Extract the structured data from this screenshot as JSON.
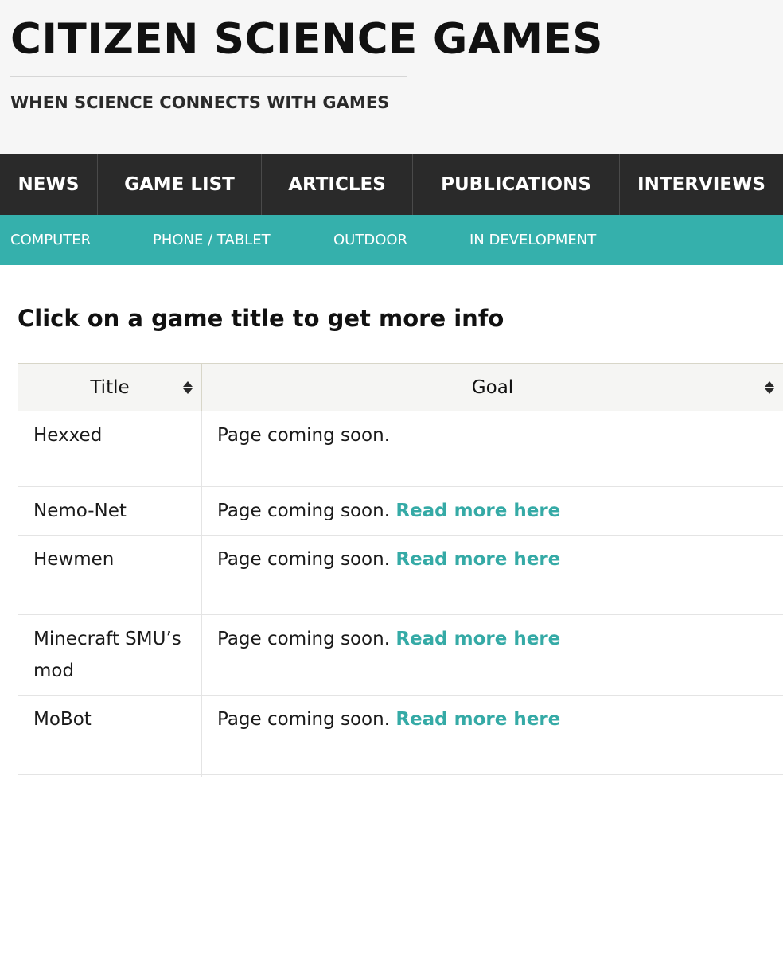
{
  "header": {
    "site_title": "CITIZEN SCIENCE GAMES",
    "tagline": "WHEN SCIENCE CONNECTS WITH GAMES"
  },
  "main_nav": {
    "items": [
      {
        "label": "NEWS"
      },
      {
        "label": "GAME LIST"
      },
      {
        "label": "ARTICLES"
      },
      {
        "label": "PUBLICATIONS"
      },
      {
        "label": "INTERVIEWS"
      }
    ]
  },
  "sub_nav": {
    "items": [
      {
        "label": "COMPUTER"
      },
      {
        "label": "PHONE / TABLET"
      },
      {
        "label": "OUTDOOR"
      },
      {
        "label": "IN DEVELOPMENT"
      }
    ]
  },
  "main": {
    "heading": "Click on a game title to get more info"
  },
  "table": {
    "columns": [
      {
        "label": "Title",
        "sort_icon": "sort-icon"
      },
      {
        "label": "Goal",
        "sort_icon": "sort-icon"
      }
    ],
    "rows": [
      {
        "title": "Hexxed",
        "goal": "Page coming soon.",
        "link": ""
      },
      {
        "title": "Nemo-Net",
        "goal": "Page coming soon.",
        "link": "Read more here"
      },
      {
        "title": "Hewmen",
        "goal": "Page coming soon.",
        "link": "Read more here"
      },
      {
        "title": "Minecraft SMU’s mod",
        "goal": "Page coming soon.",
        "link": "Read more here"
      },
      {
        "title": "MoBot",
        "goal": "Page coming soon.",
        "link": "Read more here"
      }
    ]
  },
  "colors": {
    "header_bg": "#f6f6f6",
    "main_nav_bg": "#2a2a2a",
    "sub_nav_bg": "#35b0ac",
    "link": "#35aaa6"
  }
}
